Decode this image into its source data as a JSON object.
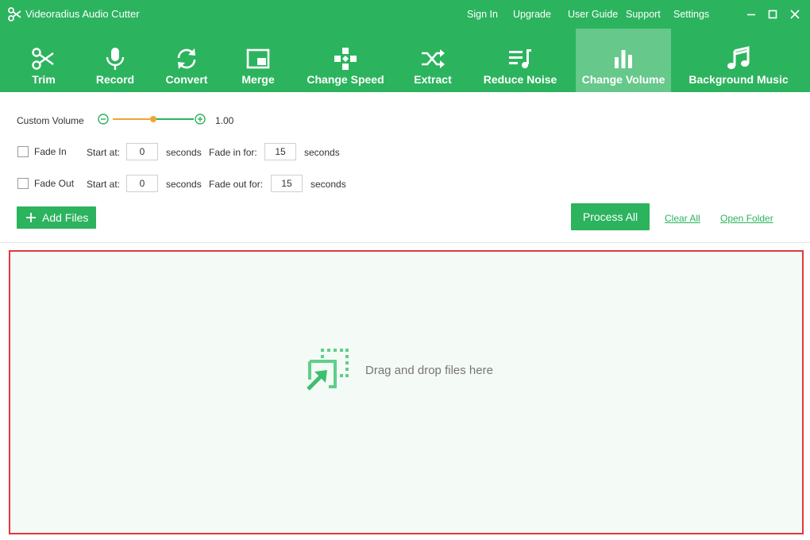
{
  "app": {
    "title": "Videoradius Audio Cutter",
    "accent_color": "#2cb35e",
    "logo_icon": "scissors-icon"
  },
  "top_links": [
    {
      "label": "Sign In"
    },
    {
      "label": "Upgrade"
    },
    {
      "label": "User Guide"
    },
    {
      "label": "Support"
    },
    {
      "label": "Settings"
    }
  ],
  "window_controls": [
    "minimize-icon",
    "maximize-icon",
    "close-icon"
  ],
  "toolbar": [
    {
      "label": "Trim",
      "icon": "scissors-icon",
      "active": false
    },
    {
      "label": "Record",
      "icon": "microphone-icon",
      "active": false
    },
    {
      "label": "Convert",
      "icon": "refresh-icon",
      "active": false
    },
    {
      "label": "Merge",
      "icon": "merge-icon",
      "active": false
    },
    {
      "label": "Change Speed",
      "icon": "gamepad-icon",
      "active": false
    },
    {
      "label": "Extract",
      "icon": "shuffle-icon",
      "active": false
    },
    {
      "label": "Reduce Noise",
      "icon": "playlist-icon",
      "active": false
    },
    {
      "label": "Change Volume",
      "icon": "bar-chart-icon",
      "active": true
    },
    {
      "label": "Background Music",
      "icon": "music-note-icon",
      "active": false
    }
  ],
  "volume": {
    "label": "Custom Volume",
    "value_text": "1.00",
    "level": 0.5,
    "track_color": "#2cb35e",
    "fill_color": "#f0a630"
  },
  "fade_in": {
    "label": "Fade In",
    "checked": false,
    "start_label": "Start at:",
    "start_value": "0",
    "unit1": "seconds",
    "for_label": "Fade in for:",
    "for_value": "15",
    "unit2": "seconds"
  },
  "fade_out": {
    "label": "Fade Out",
    "checked": false,
    "start_label": "Start at:",
    "start_value": "0",
    "unit1": "seconds",
    "for_label": "Fade out for:",
    "for_value": "15",
    "unit2": "seconds"
  },
  "actions": {
    "add_files": "Add Files",
    "process_all": "Process All",
    "clear_all": "Clear All",
    "open_folder": "Open Folder"
  },
  "dropzone": {
    "text": "Drag and drop files here",
    "border_color": "#e5373a",
    "icon": "drag-drop-icon"
  }
}
